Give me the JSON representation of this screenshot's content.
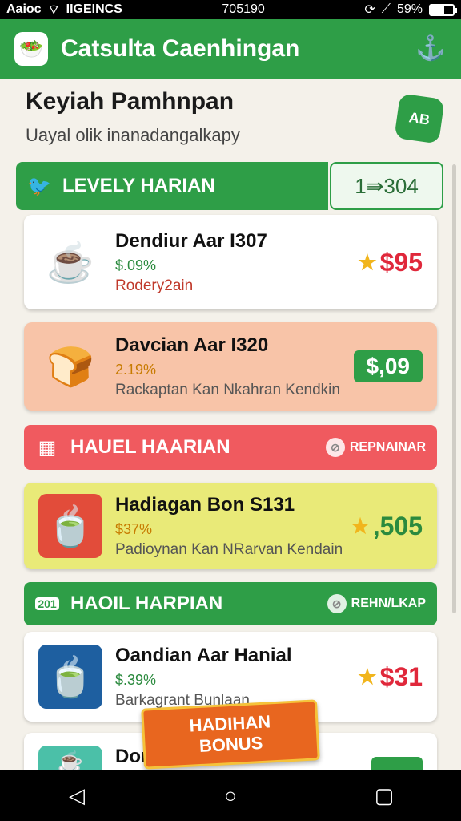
{
  "status_bar": {
    "carrier": "Aaioc",
    "network": "IIGEINCS",
    "time": "705190",
    "battery": "59%",
    "battery_level": 0.59
  },
  "app_bar": {
    "title": "Catsulta Caenhingan",
    "logo_icon": "salad-bowl-icon",
    "action_icon": "anchor-icon"
  },
  "header": {
    "title": "Keyiah Pamhnpan",
    "subtitle": "Uayal olik inanadangalkapy",
    "badge": "AB"
  },
  "section_daily": {
    "label": "LEVELY HARIAN",
    "counter": "1⇛304"
  },
  "cards": [
    {
      "title": "Dendiur Aar I307",
      "pct": "$.09%",
      "subtitle": "Rodery2ain",
      "price": "$95",
      "price_style": "star"
    },
    {
      "title": "Davcian Aar I320",
      "pct": "2.19%",
      "subtitle": "Rackaptan Kan Nkahran Kendkin",
      "price": "$,09",
      "price_style": "badge"
    }
  ],
  "section_hauel": {
    "label": "HAUEL HAARIAN",
    "action": "REPNAINAR"
  },
  "cards_two": [
    {
      "title": "Hadiagan Bon S131",
      "pct": "$37%",
      "subtitle": "Padioynan Kan NRarvan Kendain",
      "price": ",505"
    }
  ],
  "section_haoil": {
    "label": "HAOIL HARPIAN",
    "action": "REHN/LKAP",
    "date_tag": "201"
  },
  "cards_three": [
    {
      "title": "Oandian Aar Hanial",
      "pct": "$.39%",
      "subtitle": "Barkagrant Bunlaan",
      "price": "$31"
    }
  ],
  "partial_card": {
    "title": "Dona"
  },
  "bonus_banner": {
    "line1": "HADIHAN",
    "line2": "BONUS"
  },
  "colors": {
    "primary": "#2e9e47",
    "red_section": "#f05a5f",
    "price_red": "#e0283b",
    "price_green": "#2b8a3e",
    "card_peach": "#f8c4a8",
    "card_yellow": "#e9ea78"
  }
}
